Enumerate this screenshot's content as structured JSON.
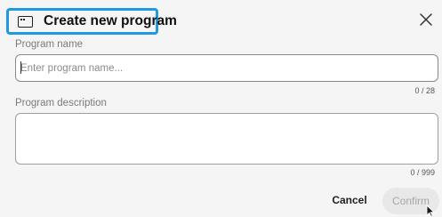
{
  "dialog": {
    "title": "Create new program",
    "close_icon": "close-icon",
    "title_icon": "window-icon"
  },
  "name_field": {
    "label": "Program name",
    "value": "",
    "placeholder": "Enter program name...",
    "counter": "0 / 28"
  },
  "description_field": {
    "label": "Program description",
    "value": "",
    "placeholder": "",
    "counter": "0 / 999"
  },
  "actions": {
    "cancel_label": "Cancel",
    "confirm_label": "Confirm"
  },
  "colors": {
    "highlight": "#1e9be0",
    "dialog_bg": "#f5f5f5",
    "confirm_disabled_bg": "#e8e8e8"
  }
}
